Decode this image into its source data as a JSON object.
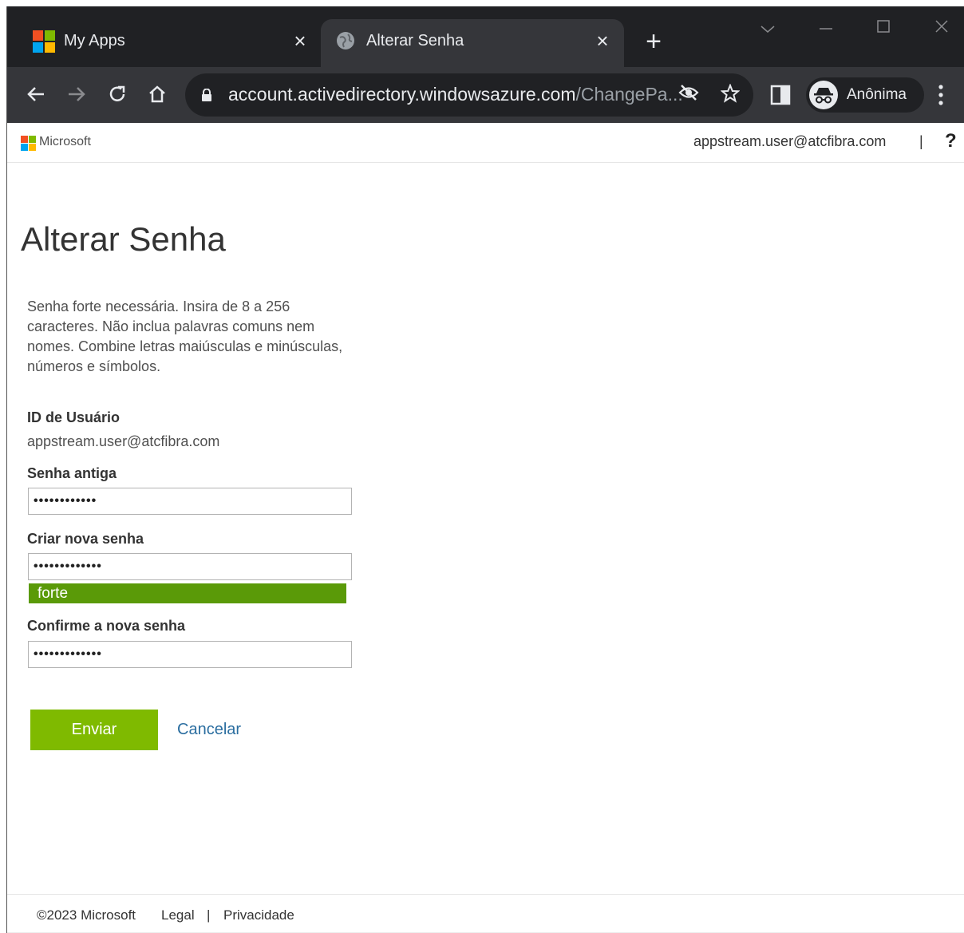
{
  "browser": {
    "tabs": [
      {
        "title": "My Apps",
        "active": false
      },
      {
        "title": "Alterar Senha",
        "active": true
      }
    ],
    "new_tab": "+",
    "close_glyph": "×",
    "url_main": "account.activedirectory.windowsazure.com",
    "url_rest": "/ChangePa...",
    "incognito_label": "Anônima",
    "icons": [
      "back-icon",
      "forward-icon",
      "reload-icon",
      "home-icon",
      "lock-icon",
      "eye-off-icon",
      "star-icon",
      "side-panel-icon",
      "incognito-icon",
      "menu-icon"
    ]
  },
  "header": {
    "brand": "Microsoft",
    "user": "appstream.user@atcfibra.com",
    "separator": "|",
    "help": "?"
  },
  "page": {
    "title": "Alterar Senha",
    "instructions": "Senha forte necessária. Insira de 8 a 256 caracteres. Não inclua palavras comuns nem nomes. Combine letras maiúsculas e minúsculas, números e símbolos.",
    "user_id_label": "ID de Usuário",
    "user_id_value": "appstream.user@atcfibra.com",
    "old_password_label": "Senha antiga",
    "old_password_value": "••••••••••••",
    "new_password_label": "Criar nova senha",
    "new_password_value": "•••••••••••••",
    "strength_label": "forte",
    "confirm_label": "Confirme a nova senha",
    "confirm_value": "•••••••••••••",
    "submit_label": "Enviar",
    "cancel_label": "Cancelar"
  },
  "footer": {
    "copyright": "©2023 Microsoft",
    "legal": "Legal",
    "separator": "|",
    "privacy": "Privacidade"
  },
  "colors": {
    "submit": "#7fba00",
    "strength": "#5a9a08",
    "link": "#2b6ea0",
    "chrome_dark": "#202124",
    "chrome_toolbar": "#35363a"
  }
}
